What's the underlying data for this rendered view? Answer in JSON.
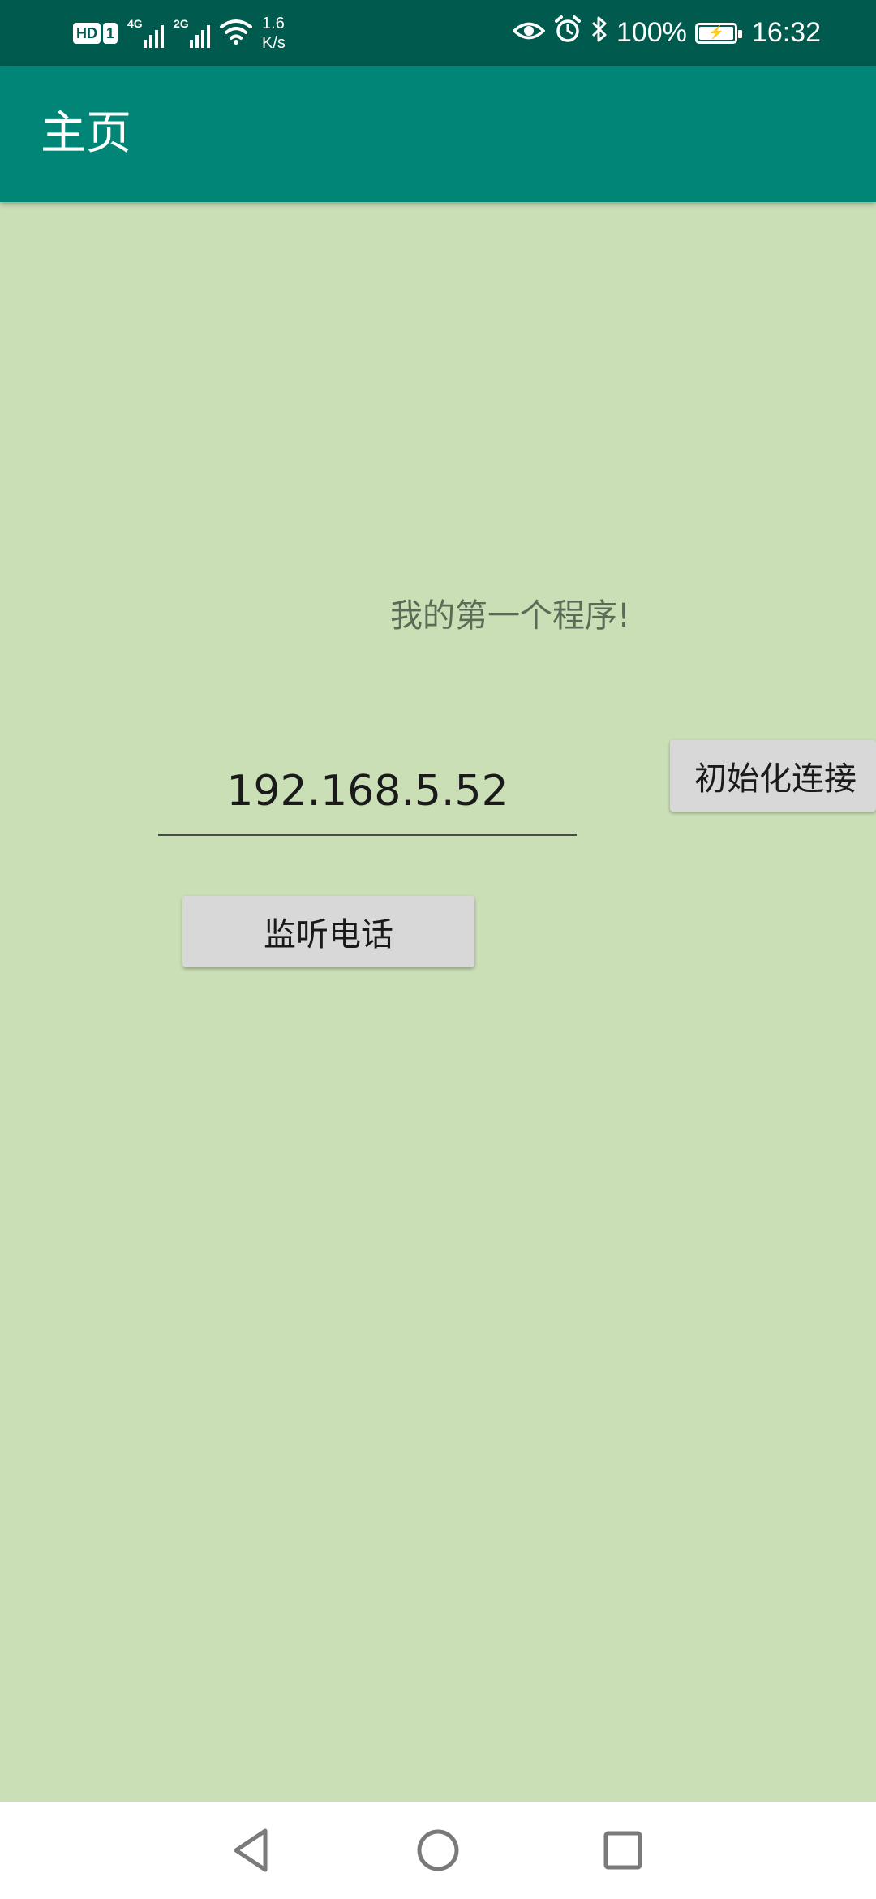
{
  "status_bar": {
    "hd_label": "HD",
    "sim_label": "1",
    "signal1_gen": "4G",
    "signal2_gen": "2G",
    "net_speed_value": "1.6",
    "net_speed_unit": "K/s",
    "icons": [
      "hd-badge",
      "signal-4g",
      "signal-2g",
      "wifi",
      "eye",
      "alarm",
      "bluetooth",
      "battery-charging"
    ],
    "battery_text": "100%",
    "battery_level": 1.0,
    "time": "16:32"
  },
  "app_bar": {
    "title": "主页"
  },
  "main": {
    "message": "我的第一个程序!",
    "ip_input_value": "192.168.5.52",
    "connect_button_label": "初始化连接",
    "listen_button_label": "监听电话"
  },
  "nav_bar": {
    "icons": [
      "back-icon",
      "home-icon",
      "recents-icon"
    ]
  },
  "colors": {
    "status_bar": "#005a4d",
    "app_bar": "#008577",
    "background": "#cbdfb6",
    "button": "#d8d8d8"
  }
}
